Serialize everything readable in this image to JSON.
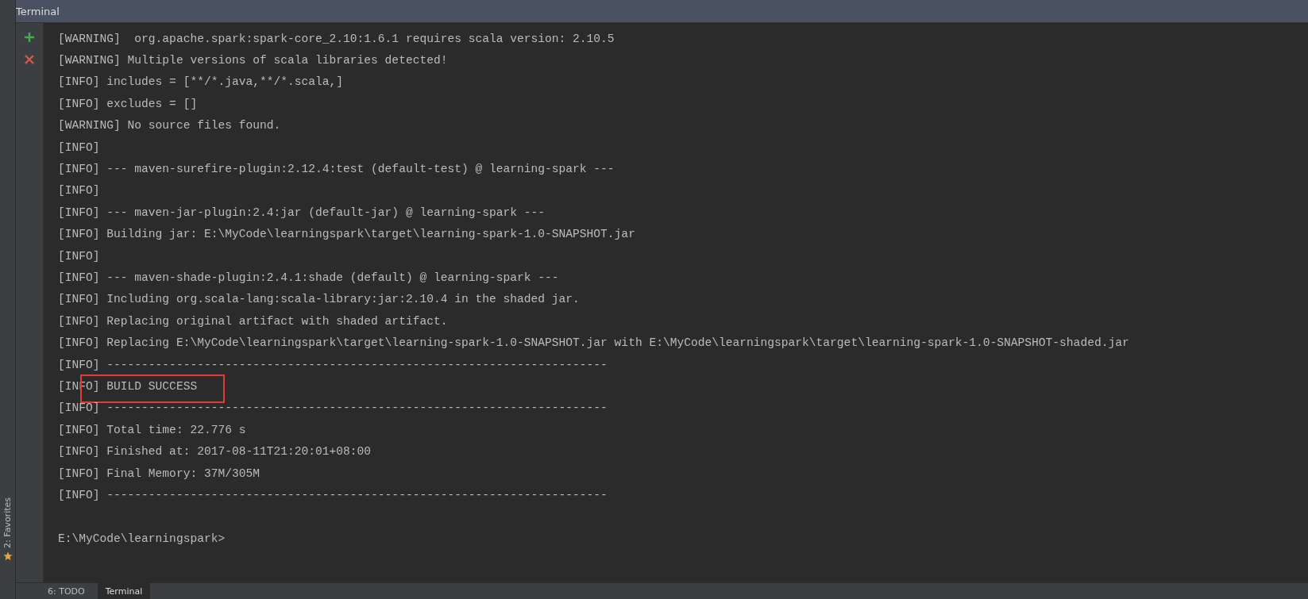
{
  "window": {
    "title": "Terminal"
  },
  "side_stripe": {
    "label": "2: Favorites"
  },
  "toolbar": {
    "buttons": [
      {
        "kind": "add"
      },
      {
        "kind": "close"
      }
    ]
  },
  "terminal": {
    "lines": [
      {
        "kind": "output",
        "text": "[WARNING]  org.apache.spark:spark-core_2.10:1.6.1 requires scala version: 2.10.5",
        "highlighted": false
      },
      {
        "kind": "output",
        "text": "[WARNING] Multiple versions of scala libraries detected!",
        "highlighted": false
      },
      {
        "kind": "output",
        "text": "[INFO] includes = [**/*.java,**/*.scala,]",
        "highlighted": false
      },
      {
        "kind": "output",
        "text": "[INFO] excludes = []",
        "highlighted": false
      },
      {
        "kind": "output",
        "text": "[WARNING] No source files found.",
        "highlighted": false
      },
      {
        "kind": "output",
        "text": "[INFO]",
        "highlighted": false
      },
      {
        "kind": "output",
        "text": "[INFO] --- maven-surefire-plugin:2.12.4:test (default-test) @ learning-spark ---",
        "highlighted": false
      },
      {
        "kind": "output",
        "text": "[INFO]",
        "highlighted": false
      },
      {
        "kind": "output",
        "text": "[INFO] --- maven-jar-plugin:2.4:jar (default-jar) @ learning-spark ---",
        "highlighted": false
      },
      {
        "kind": "output",
        "text": "[INFO] Building jar: E:\\MyCode\\learningspark\\target\\learning-spark-1.0-SNAPSHOT.jar",
        "highlighted": false
      },
      {
        "kind": "output",
        "text": "[INFO]",
        "highlighted": false
      },
      {
        "kind": "output",
        "text": "[INFO] --- maven-shade-plugin:2.4.1:shade (default) @ learning-spark ---",
        "highlighted": false
      },
      {
        "kind": "output",
        "text": "[INFO] Including org.scala-lang:scala-library:jar:2.10.4 in the shaded jar.",
        "highlighted": false
      },
      {
        "kind": "output",
        "text": "[INFO] Replacing original artifact with shaded artifact.",
        "highlighted": false
      },
      {
        "kind": "output",
        "text": "[INFO] Replacing E:\\MyCode\\learningspark\\target\\learning-spark-1.0-SNAPSHOT.jar with E:\\MyCode\\learningspark\\target\\learning-spark-1.0-SNAPSHOT-shaded.jar",
        "highlighted": false
      },
      {
        "kind": "output",
        "text": "[INFO] ------------------------------------------------------------------------",
        "highlighted": false
      },
      {
        "kind": "output",
        "text": "[INFO] BUILD SUCCESS",
        "highlighted": true
      },
      {
        "kind": "output",
        "text": "[INFO] ------------------------------------------------------------------------",
        "highlighted": false
      },
      {
        "kind": "output",
        "text": "[INFO] Total time: 22.776 s",
        "highlighted": false
      },
      {
        "kind": "output",
        "text": "[INFO] Finished at: 2017-08-11T21:20:01+08:00",
        "highlighted": false
      },
      {
        "kind": "output",
        "text": "[INFO] Final Memory: 37M/305M",
        "highlighted": false
      },
      {
        "kind": "output",
        "text": "[INFO] ------------------------------------------------------------------------",
        "highlighted": false
      },
      {
        "kind": "blank"
      },
      {
        "kind": "prompt",
        "text": "E:\\MyCode\\learningspark>",
        "highlighted": false
      }
    ]
  },
  "bottom_tabs": [
    {
      "label": "6: TODO",
      "selected": false
    },
    {
      "label": "Terminal",
      "selected": true
    }
  ]
}
